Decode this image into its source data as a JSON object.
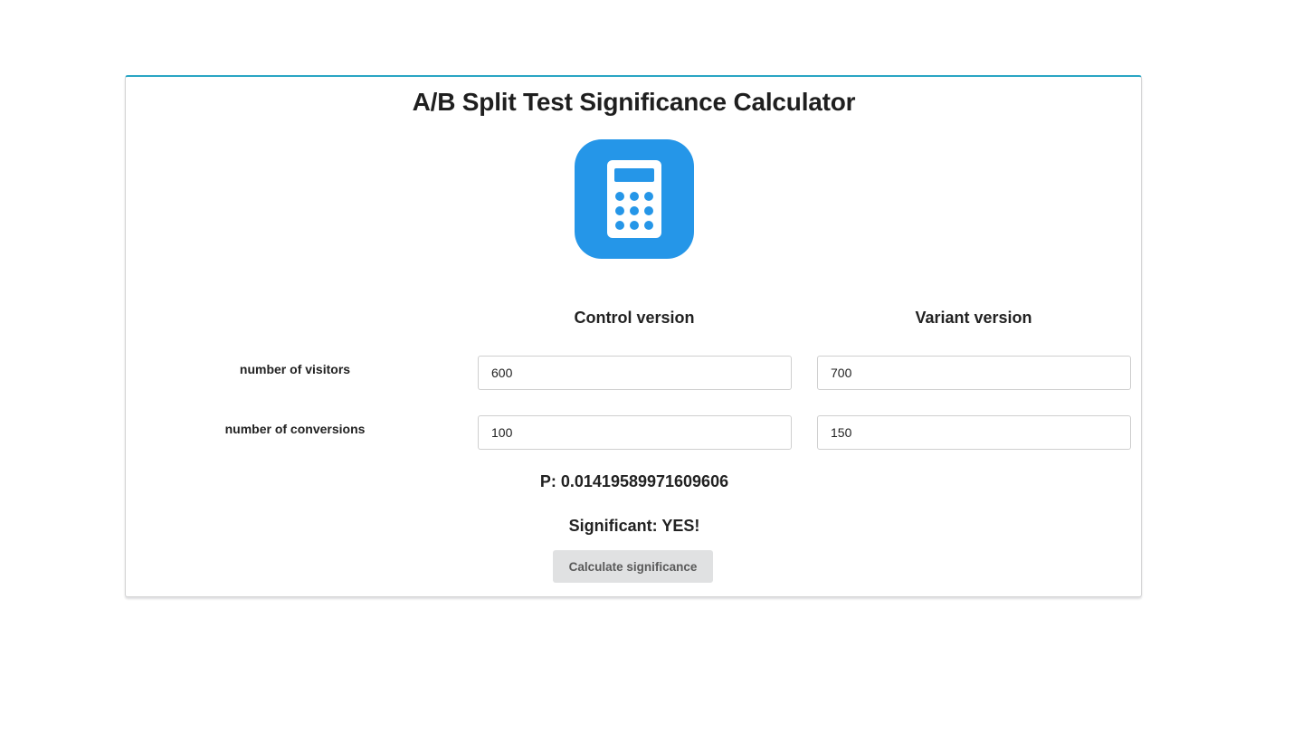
{
  "page": {
    "title": "A/B Split Test Significance Calculator"
  },
  "icons": {
    "logo": "calculator-icon"
  },
  "colors": {
    "accent": "#2aa5c4",
    "logo_background": "#2596e8",
    "button_background": "#e0e1e2"
  },
  "columns": {
    "control": "Control version",
    "variant": "Variant version"
  },
  "rows": {
    "visitors_label": "number of visitors",
    "conversions_label": "number of conversions"
  },
  "inputs": {
    "control_visitors": "600",
    "variant_visitors": "700",
    "control_conversions": "100",
    "variant_conversions": "150"
  },
  "results": {
    "p_value": "P: 0.01419589971609606",
    "significant": "Significant: YES!"
  },
  "actions": {
    "calculate_label": "Calculate significance"
  }
}
